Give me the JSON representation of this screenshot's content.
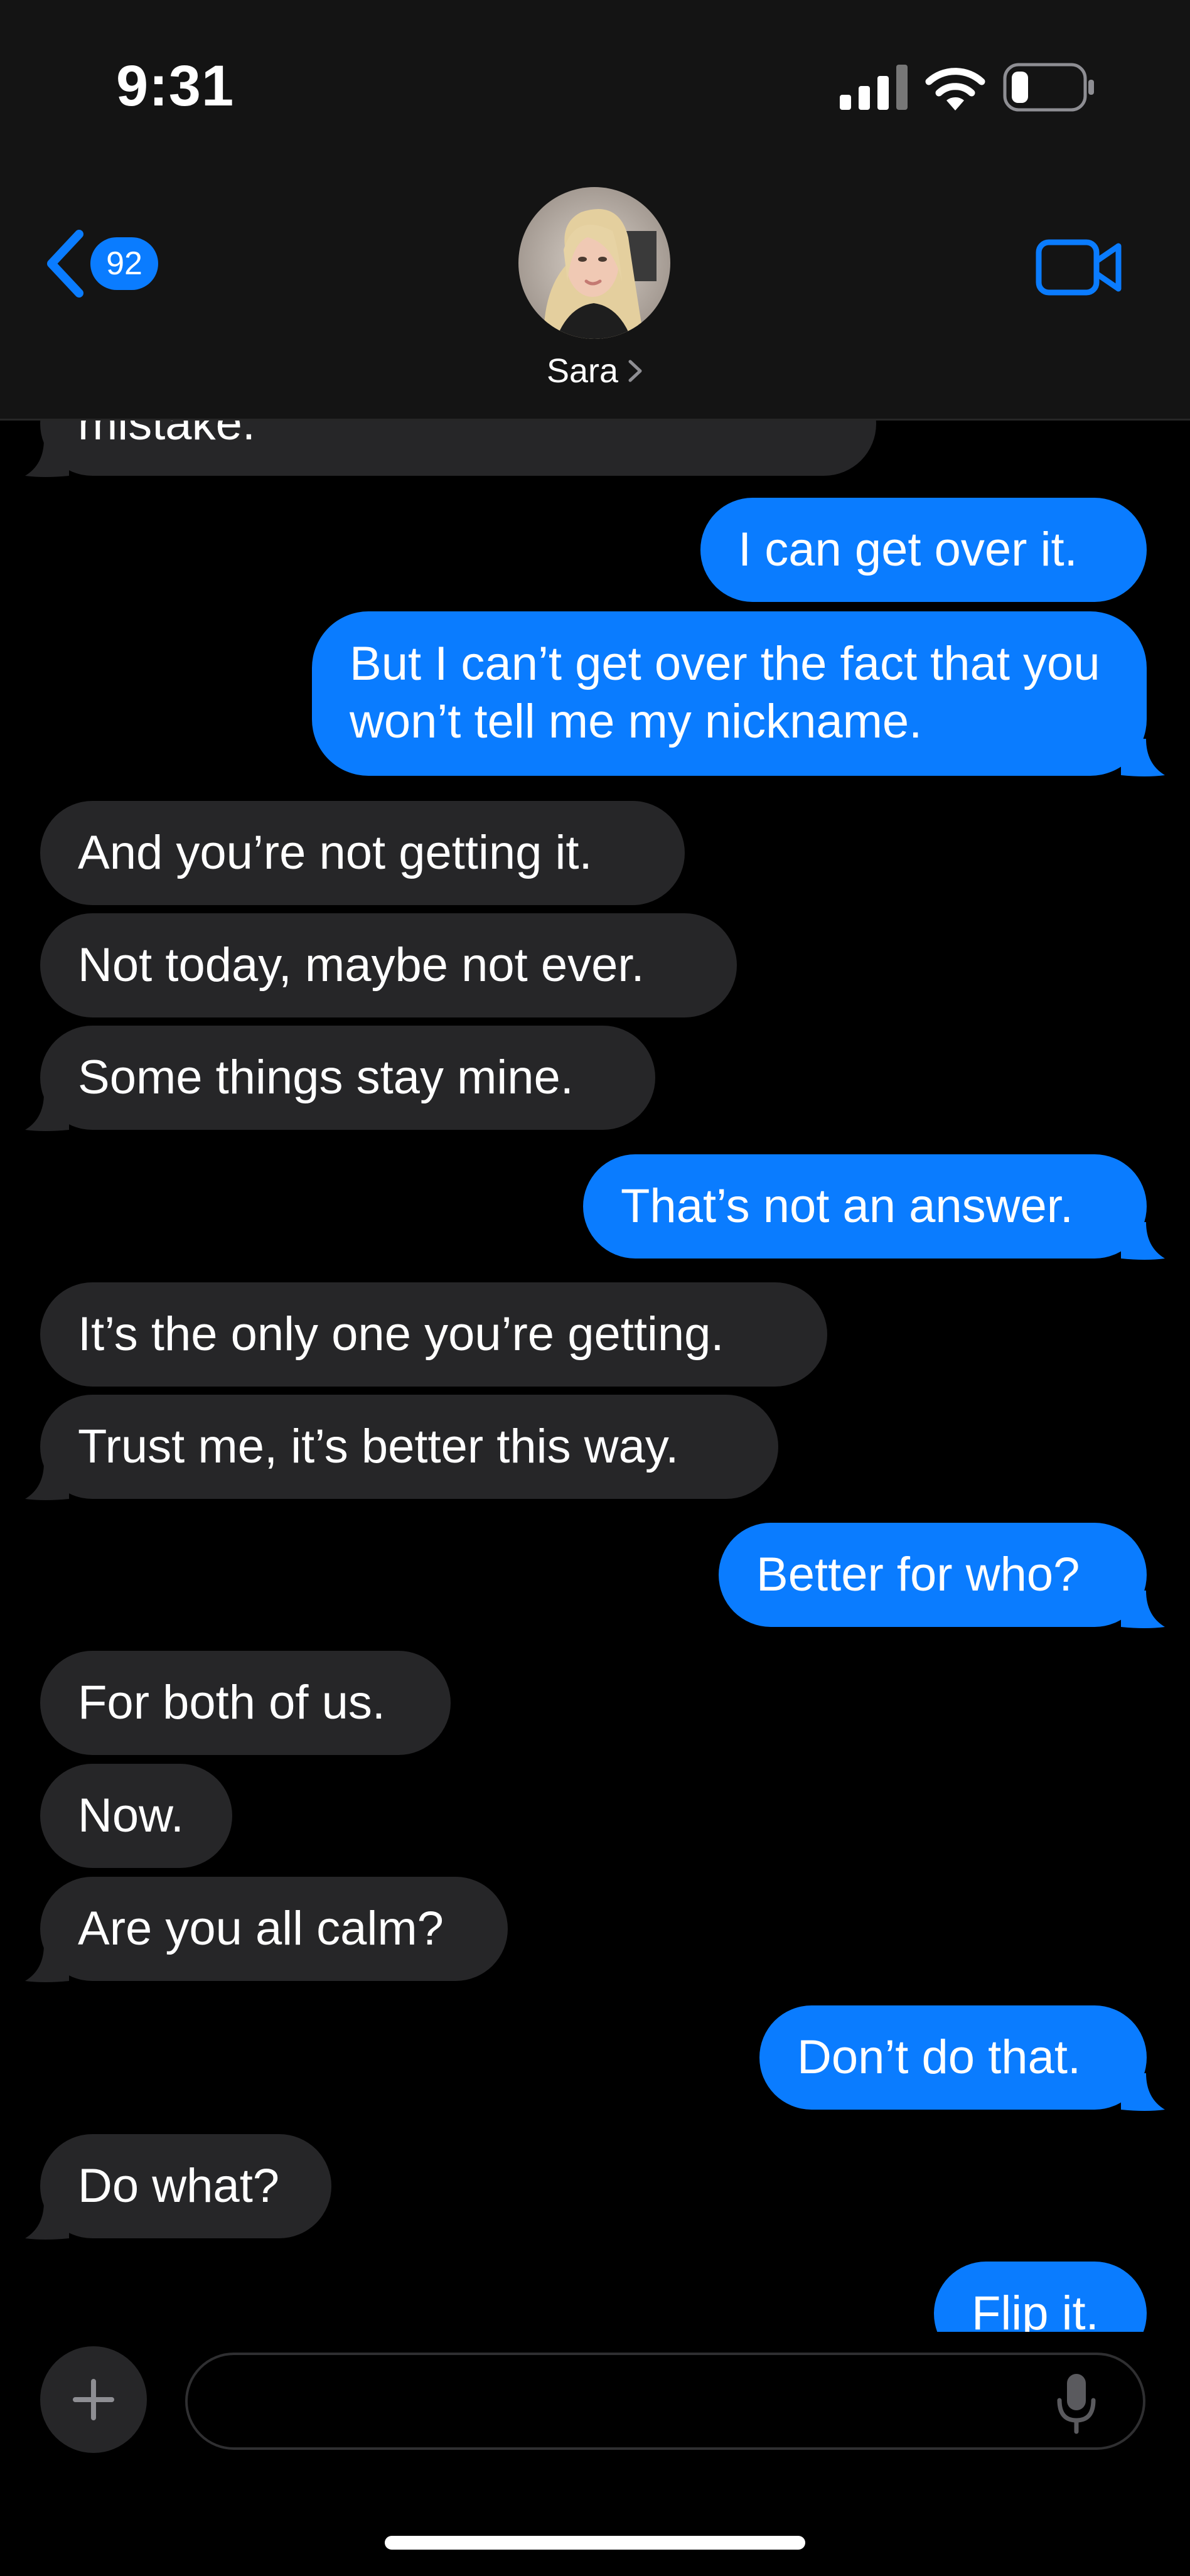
{
  "status_bar": {
    "time": "9:31"
  },
  "header": {
    "back_badge": "92",
    "contact_name": "Sara",
    "video_icon": "video-camera-icon"
  },
  "colors": {
    "incoming_bubble": "#262628",
    "outgoing_bubble": "#0a7cff",
    "accent": "#0a7cff"
  },
  "messages": [
    {
      "side": "in",
      "text": "mistake."
    },
    {
      "side": "out",
      "text": "I can get over it."
    },
    {
      "side": "out",
      "text": "But I can’t get over the fact that you won’t tell me my nickname."
    },
    {
      "side": "in",
      "text": "And you’re not getting it."
    },
    {
      "side": "in",
      "text": "Not today, maybe not ever."
    },
    {
      "side": "in",
      "text": "Some things stay mine."
    },
    {
      "side": "out",
      "text": "That’s not an answer."
    },
    {
      "side": "in",
      "text": "It’s the only one you’re getting."
    },
    {
      "side": "in",
      "text": "Trust me, it’s better this way."
    },
    {
      "side": "out",
      "text": "Better for who?"
    },
    {
      "side": "in",
      "text": "For both of us."
    },
    {
      "side": "in",
      "text": "Now."
    },
    {
      "side": "in",
      "text": "Are you all calm?"
    },
    {
      "side": "out",
      "text": "Don’t do that."
    },
    {
      "side": "in",
      "text": "Do what?"
    },
    {
      "side": "out",
      "text": "Flip it."
    }
  ],
  "composer": {
    "value": "",
    "placeholder": ""
  }
}
